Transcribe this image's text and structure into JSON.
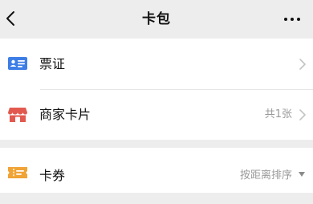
{
  "header": {
    "back_icon": "chevron-left-icon",
    "title": "卡包",
    "more_icon": "more-dots-icon"
  },
  "groups": [
    {
      "items": [
        {
          "label": "票证",
          "value": "",
          "icon": "id-card-icon",
          "icon_color": "#3d7ee6"
        },
        {
          "label": "商家卡片",
          "value": "共1张",
          "icon": "store-icon",
          "icon_color": "#e25a4f"
        }
      ]
    },
    {
      "items": [
        {
          "label": "卡券",
          "icon": "ticket-icon",
          "icon_color": "#f0a336",
          "sort_label": "按距离排序",
          "sort_icon": "caret-down-icon"
        }
      ]
    }
  ],
  "colors": {
    "background": "#ededed",
    "card": "#ffffff",
    "secondary_text": "#9a9a9a"
  }
}
